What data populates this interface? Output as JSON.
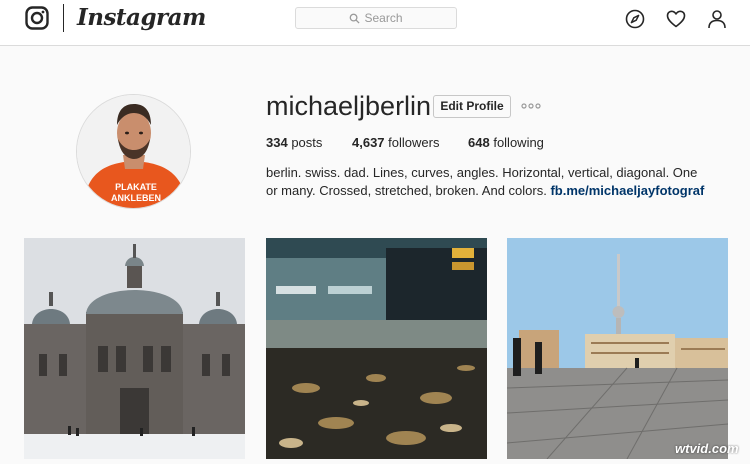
{
  "header": {
    "logo_icon": "instagram-camera-icon",
    "wordmark": "Instagram",
    "search_placeholder": "Search",
    "search_icon": "search-icon",
    "nav_icons": [
      "compass-icon",
      "heart-icon",
      "user-icon"
    ]
  },
  "profile": {
    "username": "michaeljberlin",
    "edit_label": "Edit Profile",
    "more_icon": "ellipsis-icon",
    "stats": {
      "posts_value": "334",
      "posts_label": "posts",
      "followers_value": "4,637",
      "followers_label": "followers",
      "following_value": "648",
      "following_label": "following"
    },
    "bio_text": "berlin. swiss. dad. Lines, curves, angles. Horizontal, vertical, diagonal. One or many. Crossed, stretched, broken. And colors.",
    "bio_link": "fb.me/michaeljayfotograf",
    "avatar_shirt_text_1": "PLAKATE",
    "avatar_shirt_text_2": "ANKLEBEN"
  },
  "posts": [
    {
      "subject": "berlin-cathedral-snow-photo"
    },
    {
      "subject": "tram-puddle-photo"
    },
    {
      "subject": "tv-tower-plaza-photo"
    }
  ],
  "watermark": "wtvid.com",
  "colors": {
    "link": "#003569",
    "border": "#dbdbdb",
    "background": "#fafafa",
    "text": "#262626"
  }
}
